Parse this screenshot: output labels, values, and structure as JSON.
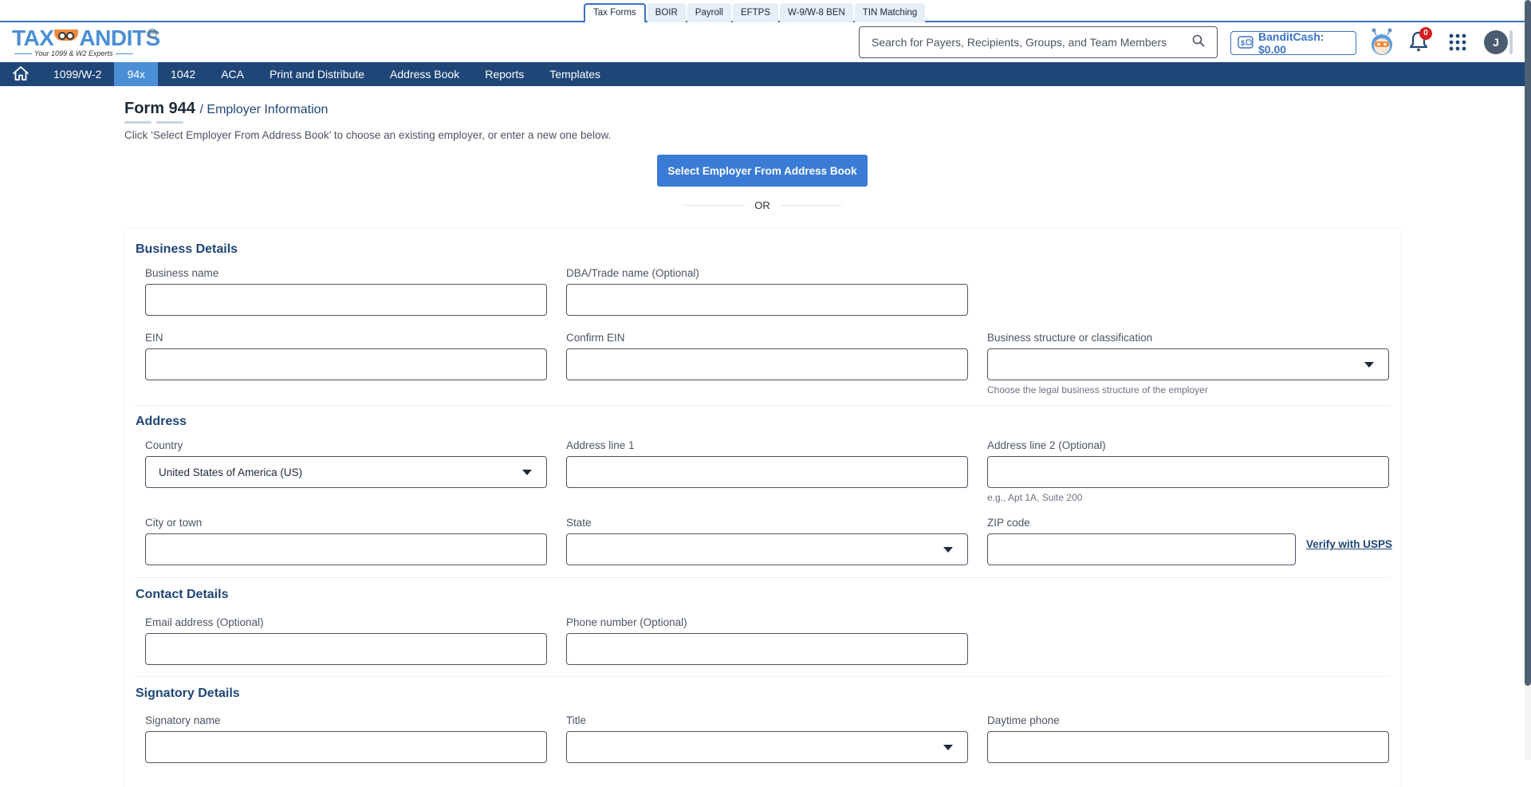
{
  "product_tabs": [
    {
      "label": "Tax Forms",
      "active": true
    },
    {
      "label": "BOIR"
    },
    {
      "label": "Payroll"
    },
    {
      "label": "EFTPS"
    },
    {
      "label": "W-9/W-8 BEN"
    },
    {
      "label": "TIN Matching"
    }
  ],
  "logo": {
    "brand": "TAXBANDITS",
    "left": "TAX",
    "right": "ANDITS",
    "tagline": "Your 1099 & W2 Experts",
    "tm": "TM"
  },
  "header": {
    "search_placeholder": "Search for Payers, Recipients, Groups, and Team Members",
    "bandit_cash": "BanditCash: $0.00",
    "notification_count": "0",
    "avatar_initial": "J"
  },
  "nav": {
    "items": [
      "1099/W-2",
      "94x",
      "1042",
      "ACA",
      "Print and Distribute",
      "Address Book",
      "Reports",
      "Templates"
    ],
    "active": "94x"
  },
  "page": {
    "title": "Form 944",
    "crumb": "/ Employer Information",
    "description": "Click ‘Select Employer From Address Book’ to choose an existing employer, or enter a new one below.",
    "select_button": "Select Employer From Address Book",
    "or": "OR"
  },
  "sections": {
    "business": {
      "title": "Business Details",
      "business_name": {
        "label": "Business name",
        "value": ""
      },
      "dba": {
        "label": "DBA/Trade name (Optional)",
        "value": ""
      },
      "ein": {
        "label": "EIN",
        "value": ""
      },
      "confirm_ein": {
        "label": "Confirm EIN",
        "value": ""
      },
      "structure": {
        "label": "Business structure or classification",
        "value": "",
        "helper": "Choose the legal business structure of the employer"
      }
    },
    "address": {
      "title": "Address",
      "country": {
        "label": "Country",
        "value": "United States of America (US)"
      },
      "line1": {
        "label": "Address line 1",
        "value": ""
      },
      "line2": {
        "label": "Address line 2 (Optional)",
        "value": "",
        "helper": "e.g., Apt 1A, Suite 200"
      },
      "city": {
        "label": "City or town",
        "value": ""
      },
      "state": {
        "label": "State",
        "value": ""
      },
      "zip": {
        "label": "ZIP code",
        "value": ""
      },
      "verify": "Verify with USPS"
    },
    "contact": {
      "title": "Contact Details",
      "email": {
        "label": "Email address (Optional)",
        "value": ""
      },
      "phone": {
        "label": "Phone number (Optional)",
        "value": ""
      }
    },
    "signatory": {
      "title": "Signatory Details",
      "name": {
        "label": "Signatory name",
        "value": ""
      },
      "title_field": {
        "label": "Title",
        "value": ""
      },
      "daytime_phone": {
        "label": "Daytime phone",
        "value": ""
      }
    }
  },
  "colors": {
    "nav_bg": "#1f4677",
    "nav_active": "#4a8fd6",
    "primary_button": "#3a7bd5",
    "badge": "#d32020"
  }
}
